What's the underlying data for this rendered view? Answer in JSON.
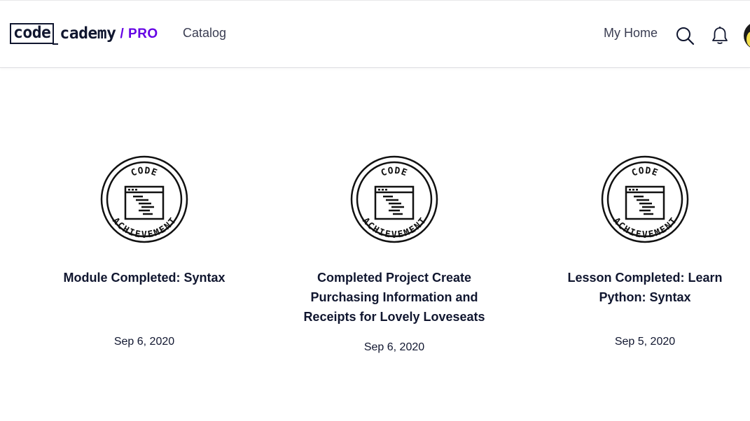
{
  "header": {
    "logo": {
      "code": "code",
      "cademy": "cademy",
      "pro": "/ PRO"
    },
    "nav": {
      "catalog": "Catalog",
      "my_home": "My Home"
    },
    "icons": {
      "search": "search-icon",
      "notifications": "bell-icon",
      "avatar": "avatar"
    },
    "colors": {
      "brand_dark": "#10162f",
      "pro_purple": "#6400e4"
    }
  },
  "badge": {
    "top_text": "CODE",
    "bottom_text": "ACHIEVEMENT"
  },
  "achievements": [
    {
      "title": "Module Completed: Syntax",
      "date": "Sep 6, 2020"
    },
    {
      "title": "Completed Project Create Purchasing Information and Receipts for Lovely Loveseats",
      "date": "Sep 6, 2020"
    },
    {
      "title": "Lesson Completed: Learn Python: Syntax",
      "date": "Sep 5, 2020"
    }
  ]
}
